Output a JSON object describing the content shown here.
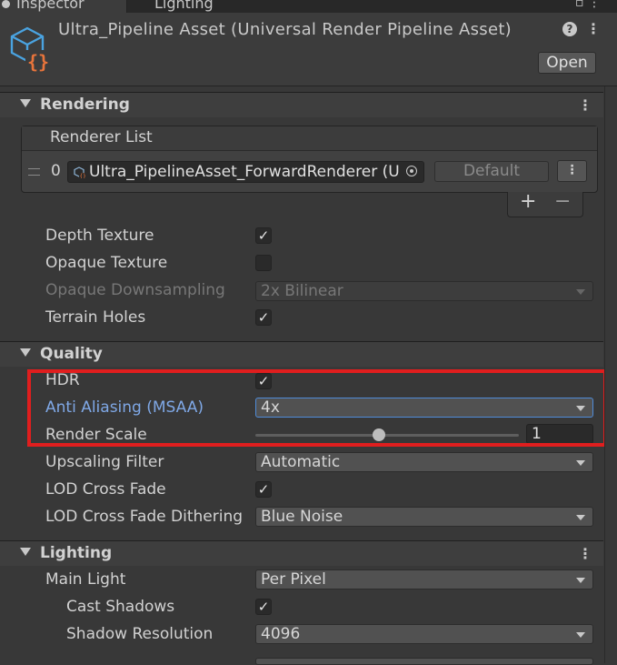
{
  "tabs": [
    {
      "label": "Inspector",
      "active": true
    },
    {
      "label": "Lighting",
      "active": false
    }
  ],
  "header": {
    "title": "Ultra_Pipeline Asset (Universal Render Pipeline Asset)",
    "open_label": "Open",
    "help_glyph": "?",
    "icon": "urp-asset-icon"
  },
  "sections": {
    "rendering": {
      "title": "Rendering",
      "renderer_list": {
        "label": "Renderer List",
        "rows": [
          {
            "index": "0",
            "value": "Ultra_PipelineAsset_ForwardRenderer (U",
            "default_label": "Default"
          }
        ],
        "add": "+",
        "remove": "−"
      },
      "depth_texture": {
        "label": "Depth Texture",
        "checked": true
      },
      "opaque_texture": {
        "label": "Opaque Texture",
        "checked": false
      },
      "opaque_downsampling": {
        "label": "Opaque Downsampling",
        "value": "2x Bilinear",
        "disabled": true
      },
      "terrain_holes": {
        "label": "Terrain Holes",
        "checked": true
      }
    },
    "quality": {
      "title": "Quality",
      "hdr": {
        "label": "HDR",
        "checked": true
      },
      "anti_aliasing": {
        "label": "Anti Aliasing (MSAA)",
        "value": "4x"
      },
      "render_scale": {
        "label": "Render Scale",
        "value": "1",
        "slider_fraction": 0.47
      },
      "upscaling_filter": {
        "label": "Upscaling Filter",
        "value": "Automatic"
      },
      "lod_cross_fade": {
        "label": "LOD Cross Fade",
        "checked": true
      },
      "lod_cross_fade_dithering": {
        "label": "LOD Cross Fade Dithering",
        "value": "Blue Noise"
      }
    },
    "lighting": {
      "title": "Lighting",
      "main_light": {
        "label": "Main Light",
        "value": "Per Pixel"
      },
      "cast_shadows": {
        "label": "Cast Shadows",
        "checked": true
      },
      "shadow_resolution": {
        "label": "Shadow Resolution",
        "value": "4096"
      }
    }
  },
  "colors": {
    "background": "#383838",
    "highlight_box": "#e01e1e",
    "focus_label": "#7fa8e6",
    "focus_border": "#4f8bd8",
    "icon_blue": "#4aa3e0",
    "icon_orange": "#e8743b"
  },
  "glyphs": {
    "check": "✓",
    "kebab": "⋮"
  }
}
